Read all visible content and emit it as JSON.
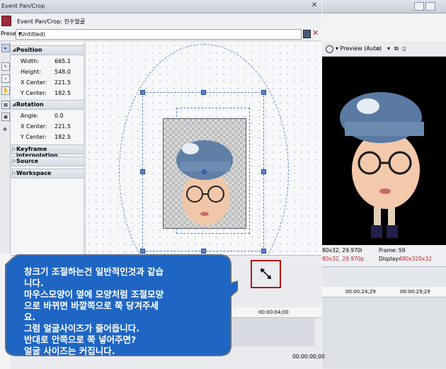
{
  "window": {
    "title": "Event Pan/Crop"
  },
  "fx_header": {
    "title": "Event Pan/Crop: 진수얼굴"
  },
  "preset": {
    "label": "Preset:",
    "value": "(Untitled)",
    "arrow": "▾"
  },
  "sections": {
    "position": {
      "label": "Position",
      "rows": [
        {
          "key": "Width:",
          "value": "665.1"
        },
        {
          "key": "Height:",
          "value": "548.0"
        },
        {
          "key": "X Center:",
          "value": "221.5"
        },
        {
          "key": "Y Center:",
          "value": "182.5"
        }
      ]
    },
    "rotation": {
      "label": "Rotation",
      "rows": [
        {
          "key": "Angle:",
          "value": "0.0"
        },
        {
          "key": "X Center:",
          "value": "221.5"
        },
        {
          "key": "Y Center:",
          "value": "182.5"
        }
      ]
    },
    "keyframe": {
      "label": "Keyframe interpolation"
    },
    "source": {
      "label": "Source"
    },
    "workspace": {
      "label": "Workspace"
    }
  },
  "preview": {
    "mode": "▾ Preview (Auto)",
    "info": {
      "left1": "80x32, 29.970i",
      "left2": "80x32, 29.970p",
      "frame_label": "Frame:",
      "frame_value": "59",
      "display_label": "Display:",
      "display_value": "480x320x32"
    }
  },
  "timeline_right": {
    "tick1": "00:00:24;29",
    "tick2": "00:00:29;29"
  },
  "timeline_left": {
    "tick1": "00:00:04;00",
    "time": "00:00:00;00"
  },
  "callout": {
    "lines": [
      "창크기 조절하는건 일반적인것과 같습",
      "니다.",
      "마우스모양이 옆에 모양처럼 조절모양",
      "으로 바뀌면 바깥쪽으로 쭉 당겨주세",
      "요.",
      "그럼 얼굴사이즈가 줄어듭니다.",
      "반대로 안쪽으로 쭉 넣어주면?",
      "얼굴 사이즈는 커집니다."
    ],
    "fill": "#1f66c4",
    "stroke": "#5a6f86"
  },
  "cursor_icon": "resize-diagonal-icon",
  "colors": {
    "highlight_border": "#b01515",
    "handle": "#5b82c4"
  }
}
